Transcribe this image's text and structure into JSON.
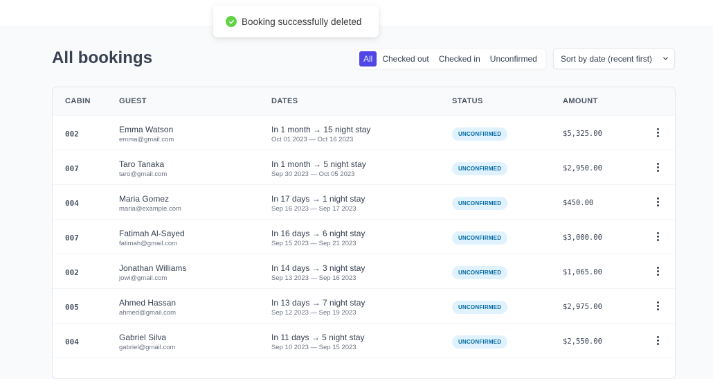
{
  "toast": {
    "message": "Booking successfully deleted",
    "icon": "check-circle-icon",
    "icon_color": "#61d345"
  },
  "page": {
    "title": "All bookings"
  },
  "filter": {
    "options": [
      {
        "label": "All",
        "active": true
      },
      {
        "label": "Checked out",
        "active": false
      },
      {
        "label": "Checked in",
        "active": false
      },
      {
        "label": "Unconfirmed",
        "active": false
      }
    ],
    "accent": "#4f46e5"
  },
  "sort": {
    "selected": "Sort by date (recent first)"
  },
  "table": {
    "headers": {
      "cabin": "CABIN",
      "guest": "GUEST",
      "dates": "DATES",
      "status": "STATUS",
      "amount": "AMOUNT"
    },
    "rows": [
      {
        "cabin": "002",
        "name": "Emma Watson",
        "email": "emma@gmail.com",
        "when": "In 1 month → 15 night stay",
        "range": "Oct 01 2023 — Oct 16 2023",
        "status": "UNCONFIRMED",
        "amount": "$5,325.00"
      },
      {
        "cabin": "007",
        "name": "Taro Tanaka",
        "email": "taro@gmail.com",
        "when": "In 1 month → 5 night stay",
        "range": "Sep 30 2023 — Oct 05 2023",
        "status": "UNCONFIRMED",
        "amount": "$2,950.00"
      },
      {
        "cabin": "004",
        "name": "Maria Gomez",
        "email": "maria@example.com",
        "when": "In 17 days → 1 night stay",
        "range": "Sep 16 2023 — Sep 17 2023",
        "status": "UNCONFIRMED",
        "amount": "$450.00"
      },
      {
        "cabin": "007",
        "name": "Fatimah Al-Sayed",
        "email": "fatimah@gmail.com",
        "when": "In 16 days → 6 night stay",
        "range": "Sep 15 2023 — Sep 21 2023",
        "status": "UNCONFIRMED",
        "amount": "$3,000.00"
      },
      {
        "cabin": "002",
        "name": "Jonathan Williams",
        "email": "jowi@gmail.com",
        "when": "In 14 days → 3 night stay",
        "range": "Sep 13 2023 — Sep 16 2023",
        "status": "UNCONFIRMED",
        "amount": "$1,065.00"
      },
      {
        "cabin": "005",
        "name": "Ahmed Hassan",
        "email": "ahmed@gmail.com",
        "when": "In 13 days → 7 night stay",
        "range": "Sep 12 2023 — Sep 19 2023",
        "status": "UNCONFIRMED",
        "amount": "$2,975.00"
      },
      {
        "cabin": "004",
        "name": "Gabriel Silva",
        "email": "gabriel@gmail.com",
        "when": "In 11 days → 5 night stay",
        "range": "Sep 10 2023 — Sep 15 2023",
        "status": "UNCONFIRMED",
        "amount": "$2,550.00"
      }
    ]
  },
  "colors": {
    "status_bg": "#e0f2fe",
    "status_text": "#0369a1"
  }
}
